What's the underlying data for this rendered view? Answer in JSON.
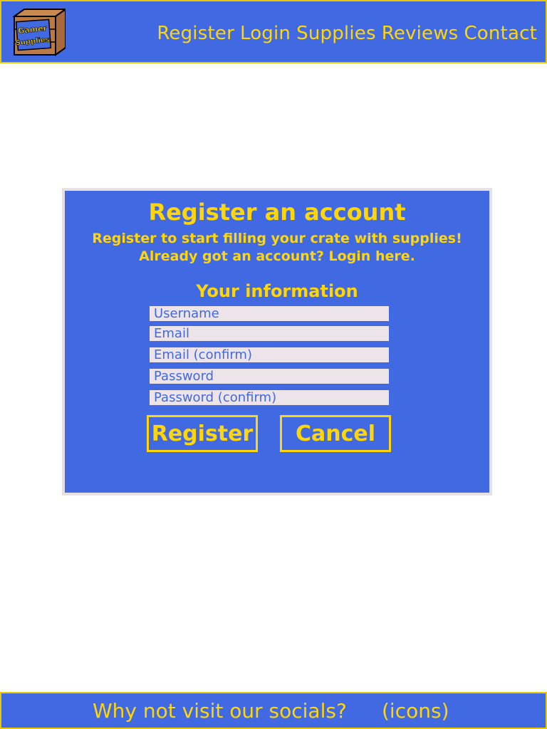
{
  "header": {
    "logo_text_line1": "Gamer",
    "logo_text_line2": "Supplies",
    "nav": [
      "Register",
      "Login",
      "Supplies",
      "Reviews",
      "Contact"
    ]
  },
  "register_form": {
    "title": "Register an account",
    "subtitle": "Register to start filling your crate with supplies!",
    "login_prompt": "Already got an account? Login here.",
    "section_title": "Your information",
    "fields": [
      {
        "placeholder": "Username",
        "value": ""
      },
      {
        "placeholder": "Email",
        "value": ""
      },
      {
        "placeholder": "Email (confirm)",
        "value": ""
      },
      {
        "placeholder": "Password",
        "value": ""
      },
      {
        "placeholder": "Password (confirm)",
        "value": ""
      }
    ],
    "register_label": "Register",
    "cancel_label": "Cancel"
  },
  "footer": {
    "socials_text": "Why not visit our socials?",
    "icons_placeholder": "(icons)"
  },
  "colors": {
    "primary_blue": "#4169e1",
    "accent_yellow": "#ffd60a",
    "border_yellow": "#e8c800",
    "field_bg": "#ece4e8",
    "page_bg": "#ffffff"
  }
}
